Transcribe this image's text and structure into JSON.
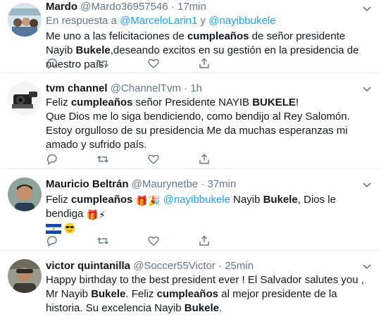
{
  "tweets": [
    {
      "name": "Mardo",
      "handle": "@Mardo36957546",
      "dot": "·",
      "time": "17min",
      "reply_prefix": "En respuesta a",
      "reply_mention_1": "@MarceloLarin1",
      "reply_and": "y",
      "reply_mention_2": "@nayibbukele",
      "t1": "Me uno a las felicitaciones de ",
      "b1": "cumpleaños",
      "t2": " de señor presidente Nayib ",
      "b2": "Bukele",
      "t3": ",deseando excitos en su gestión en la presidencia de nuestro país."
    },
    {
      "name": "tvm channel",
      "handle": "@ChannelTvm",
      "dot": "·",
      "time": "1h",
      "t1": "Feliz ",
      "b1": "cumpleaños",
      "t2": " señor Presidente NAYIB ",
      "b2": "BUKELE",
      "t3": "!",
      "t4": "Que Dios me lo siga bendiciendo, como bendijo al Rey Salomón. Estoy orgulloso de su presidencia Me da muchas esperanzas mi amado y sufrido país."
    },
    {
      "name": "Mauricio Beltrán",
      "handle": "@Maurynetbe",
      "dot": "·",
      "time": "37min",
      "t1": "Feliz ",
      "b1": "cumpleaños",
      "mention": "@nayibbukele",
      "t2": " Nayib ",
      "b2": "Bukele",
      "t3": ", Dios le bendiga",
      "emoji_names": [
        "gift-emoji",
        "party-popper-emoji",
        "gift-emoji",
        "lightning-emoji",
        "el-salvador-flag-emoji",
        "sunglasses-emoji"
      ]
    },
    {
      "name": "victor quintanilla",
      "handle": "@Soccer55Victor",
      "dot": "·",
      "time": "25min",
      "t1": "Happy birthday to the best president ever !  El Salvador salutes you , Mr Nayib ",
      "b1": "Bukele",
      "t2": ". Feliz ",
      "b2": "cumpleaños",
      "t3": " al mejor presidente de la historia. Su excelencia Nayib  ",
      "b3": "Bukele",
      "t4": "."
    }
  ],
  "actions": [
    "reply-icon",
    "retweet-icon",
    "like-icon",
    "share-icon"
  ],
  "colors": {
    "link": "#1da1f2",
    "muted": "#657786",
    "divider": "#e6ecf0",
    "text": "#14171a"
  }
}
